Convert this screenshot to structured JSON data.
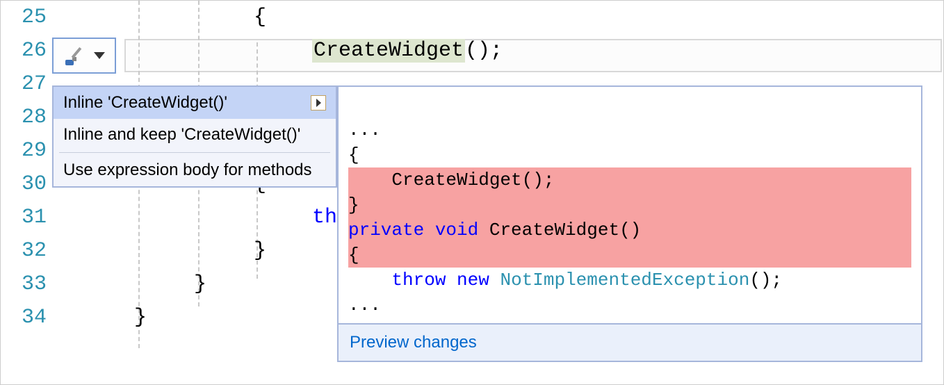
{
  "line_numbers": [
    "25",
    "26",
    "27",
    "28",
    "29",
    "30",
    "31",
    "32",
    "33",
    "34"
  ],
  "code_lines": {
    "l25": "{",
    "l26_call": "CreateWidget",
    "l26_rest": "();",
    "l27": "",
    "l28": "",
    "l29": "",
    "l30": "{",
    "l31_kw": "th",
    "l32": "}",
    "l33": "}",
    "l34": "}"
  },
  "quickfix": {
    "item1": "Inline 'CreateWidget()'",
    "item2": "Inline and keep 'CreateWidget()'",
    "item3": "Use expression body for methods"
  },
  "preview": {
    "dots1": "...",
    "brace_open": "{",
    "call_line": "    CreateWidget();",
    "brace_close": "}",
    "blank": "",
    "sig_private": "private",
    "sig_void": " void",
    "sig_name": " CreateWidget()",
    "body_open": "{",
    "throw_kw": "    throw",
    "new_kw": " new",
    "exc_type": " NotImplementedException",
    "exc_rest": "();",
    "dots2": "...",
    "footer_link": "Preview changes"
  }
}
